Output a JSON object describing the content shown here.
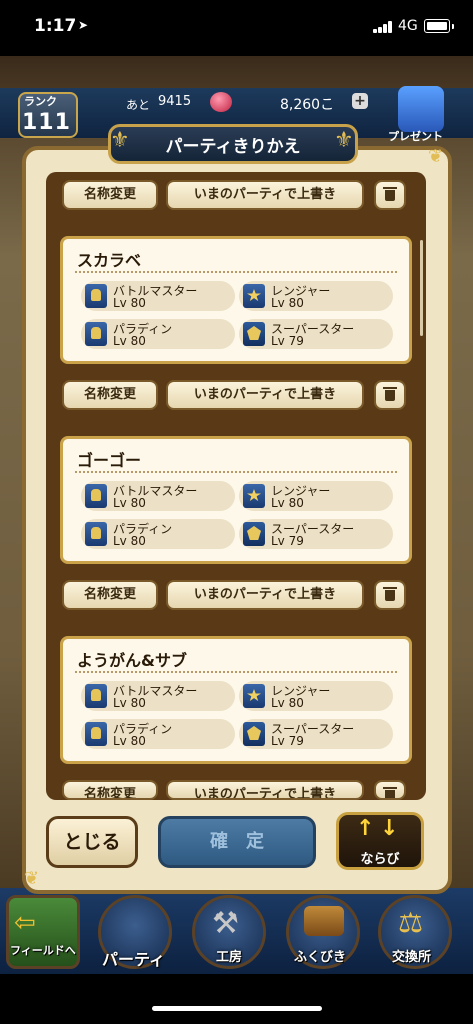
{
  "status_bar": {
    "time": "1:17",
    "network": "4G"
  },
  "header": {
    "rank_label": "ランク",
    "rank_value": "111",
    "exp_label": "あと",
    "exp_value": "9415",
    "gold_value": "8,260こ",
    "plus": "+",
    "present_label": "プレゼント"
  },
  "modal": {
    "title": "パーティきりかえ",
    "rename_label": "名称変更",
    "overwrite_label": "いまのパーティで上書き",
    "parties": [
      {
        "name": "スカラベ",
        "members": [
          {
            "job": "バトルマスター",
            "level": "Lv 80",
            "icon": "battle-master-icon"
          },
          {
            "job": "レンジャー",
            "level": "Lv 80",
            "icon": "ranger-icon"
          },
          {
            "job": "パラディン",
            "level": "Lv 80",
            "icon": "paladin-icon"
          },
          {
            "job": "スーパースター",
            "level": "Lv 79",
            "icon": "superstar-icon"
          }
        ]
      },
      {
        "name": "ゴーゴー",
        "members": [
          {
            "job": "バトルマスター",
            "level": "Lv 80",
            "icon": "battle-master-icon"
          },
          {
            "job": "レンジャー",
            "level": "Lv 80",
            "icon": "ranger-icon"
          },
          {
            "job": "パラディン",
            "level": "Lv 80",
            "icon": "paladin-icon"
          },
          {
            "job": "スーパースター",
            "level": "Lv 79",
            "icon": "superstar-icon"
          }
        ]
      },
      {
        "name": "ようがん&サブ",
        "members": [
          {
            "job": "バトルマスター",
            "level": "Lv 80",
            "icon": "battle-master-icon"
          },
          {
            "job": "レンジャー",
            "level": "Lv 80",
            "icon": "ranger-icon"
          },
          {
            "job": "パラディン",
            "level": "Lv 80",
            "icon": "paladin-icon"
          },
          {
            "job": "スーパースター",
            "level": "Lv 79",
            "icon": "superstar-icon"
          }
        ]
      }
    ],
    "close_label": "とじる",
    "confirm_label": "確定",
    "sort_label": "ならび"
  },
  "bottom_nav": {
    "field_label": "フィールドへ",
    "party_label": "パーティ",
    "workshop_label": "工房",
    "lottery_label": "ふくびき",
    "exchange_label": "交換所"
  },
  "colors": {
    "modal_bg": "#efe4c4",
    "frame": "#5a3a16",
    "accent_gold": "#c9a24a",
    "confirm": "#2e5a82"
  }
}
